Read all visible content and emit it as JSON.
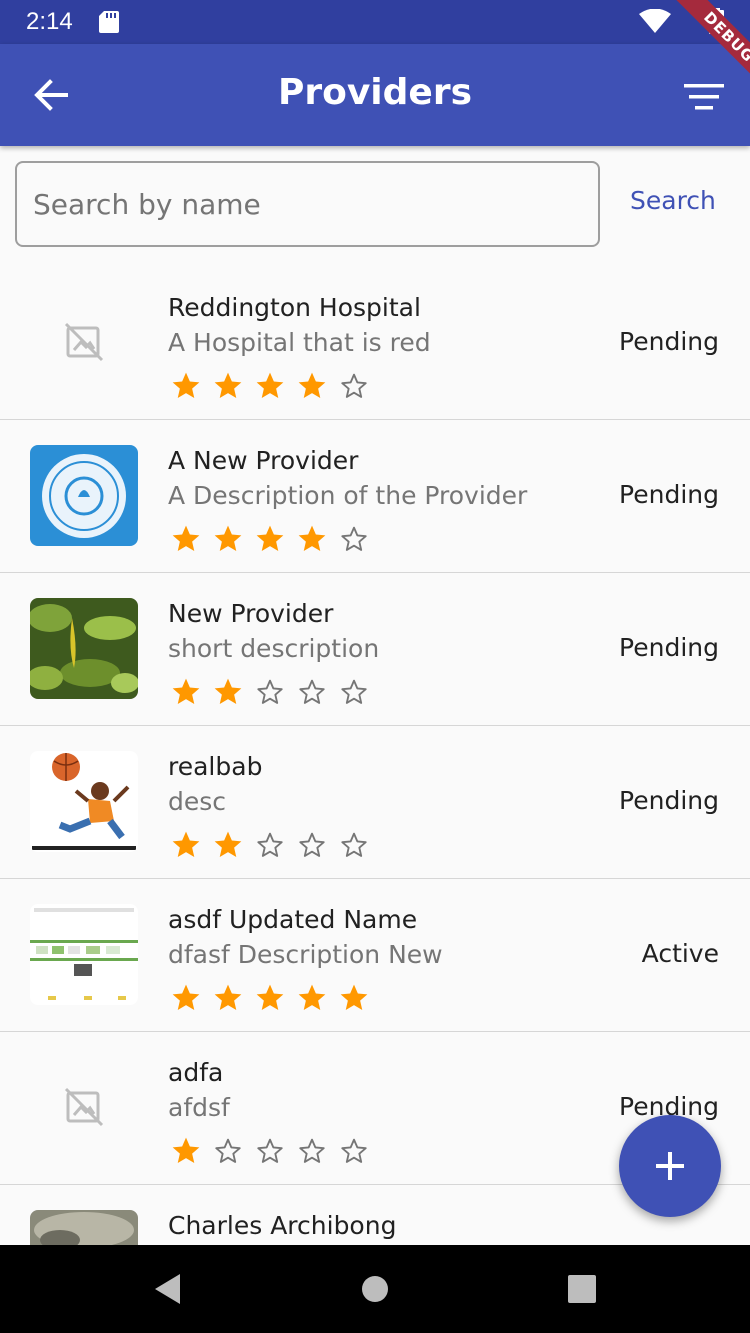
{
  "status_bar": {
    "time": "2:14",
    "icons": [
      "sd-card-icon",
      "wifi-icon",
      "battery-icon"
    ]
  },
  "debug_banner": "DEBUG",
  "app_bar": {
    "title": "Providers",
    "back_icon": "arrow-back-icon",
    "filter_icon": "filter-list-icon"
  },
  "search": {
    "placeholder": "Search by name",
    "value": "",
    "button_label": "Search"
  },
  "providers": [
    {
      "name": "Reddington Hospital",
      "description": "A Hospital that is red",
      "rating": 4,
      "status": "Pending",
      "image": "placeholder"
    },
    {
      "name": "A New Provider",
      "description": "A Description of the Provider",
      "rating": 4,
      "status": "Pending",
      "image": "logo-badge"
    },
    {
      "name": "New Provider",
      "description": "short description",
      "rating": 2,
      "status": "Pending",
      "image": "plant-photo"
    },
    {
      "name": "realbab",
      "description": "desc",
      "rating": 2,
      "status": "Pending",
      "image": "basketball-illustration"
    },
    {
      "name": "asdf Updated Name",
      "description": "dfasf Description New",
      "rating": 5,
      "status": "Active",
      "image": "website-screenshot"
    },
    {
      "name": "adfa",
      "description": "afdsf",
      "rating": 1,
      "status": "Pending",
      "image": "placeholder"
    },
    {
      "name": "Charles Archibong",
      "description": "",
      "rating": 0,
      "status": "",
      "image": "photo"
    }
  ],
  "fab": {
    "icon": "add-icon"
  },
  "nav_bar": {
    "buttons": [
      "back-triangle-icon",
      "home-circle-icon",
      "recents-square-icon"
    ]
  },
  "colors": {
    "primary": "#3f51b5",
    "primary_dark": "#303f9f",
    "star": "#ff9800",
    "debug": "#a52a3d"
  }
}
